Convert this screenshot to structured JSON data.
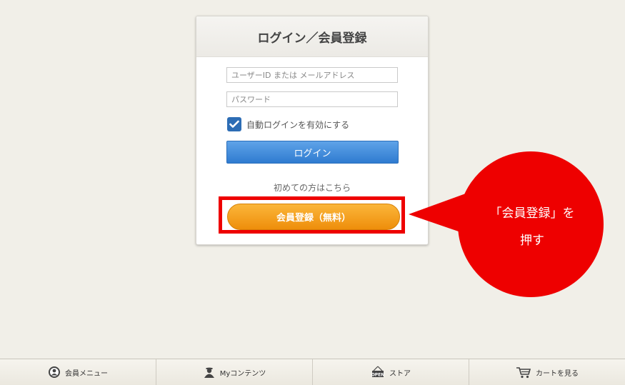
{
  "login_panel": {
    "title": "ログイン／会員登録",
    "user_id_placeholder": "ユーザーID または メールアドレス",
    "password_placeholder": "パスワード",
    "auto_login_label": "自動ログインを有効にする",
    "auto_login_checked": true,
    "login_button": "ログイン",
    "first_time_text": "初めての方はこちら",
    "register_button": "会員登録（無料）"
  },
  "callout": {
    "line1": "「会員登録」を",
    "line2": "押す",
    "color": "#ee0000"
  },
  "footer": {
    "items": [
      {
        "label": "会員メニュー",
        "icon": "member-icon"
      },
      {
        "label": "Myコンテンツ",
        "icon": "person-icon"
      },
      {
        "label": "ストア",
        "icon": "store-open-sign-icon"
      },
      {
        "label": "カートを見る",
        "icon": "cart-icon"
      }
    ]
  },
  "colors": {
    "background": "#f1efe8",
    "login_button": "#3b86d8",
    "register_button": "#f4a021",
    "checkbox": "#2d6db5",
    "highlight": "#ee0000"
  }
}
